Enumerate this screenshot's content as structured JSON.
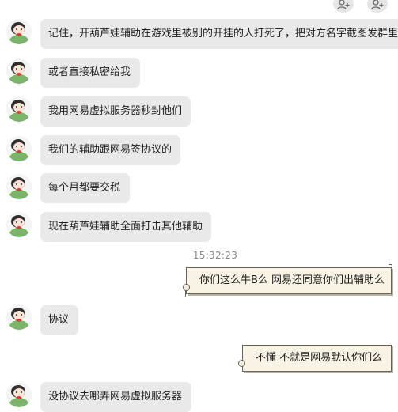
{
  "header": {
    "actions": [
      {
        "name": "add-contact-button-1",
        "icon": "add-person-icon"
      },
      {
        "name": "add-contact-button-2",
        "icon": "add-person-icon"
      }
    ]
  },
  "messages": [
    {
      "side": "left",
      "text": "记住，开葫芦娃辅助在游戏里被别的开挂的人打死了，把对方名字截图发群里"
    },
    {
      "side": "left",
      "text": "或者直接私密给我"
    },
    {
      "side": "left",
      "text": "我用网易虚拟服务器秒封他们"
    },
    {
      "side": "left",
      "text": "我们的辅助跟网易签协议的"
    },
    {
      "side": "left",
      "text": "每个月都要交税"
    },
    {
      "side": "left",
      "text": "现在葫芦娃辅助全面打击其他辅助"
    },
    {
      "side": "timestamp",
      "text": "15:32:23"
    },
    {
      "side": "right",
      "text": "你们这么牛B么 网易还同意你们出辅助么"
    },
    {
      "side": "left",
      "text": "协议"
    },
    {
      "side": "right",
      "text": "不懂  不就是网易默认你们么"
    },
    {
      "side": "left",
      "text": "没协议去哪弄网易虚拟服务器"
    }
  ],
  "colors": {
    "left_bubble": "#e9e9e9",
    "right_bubble_paper": "#f8f3e4",
    "timestamp": "#888888"
  }
}
